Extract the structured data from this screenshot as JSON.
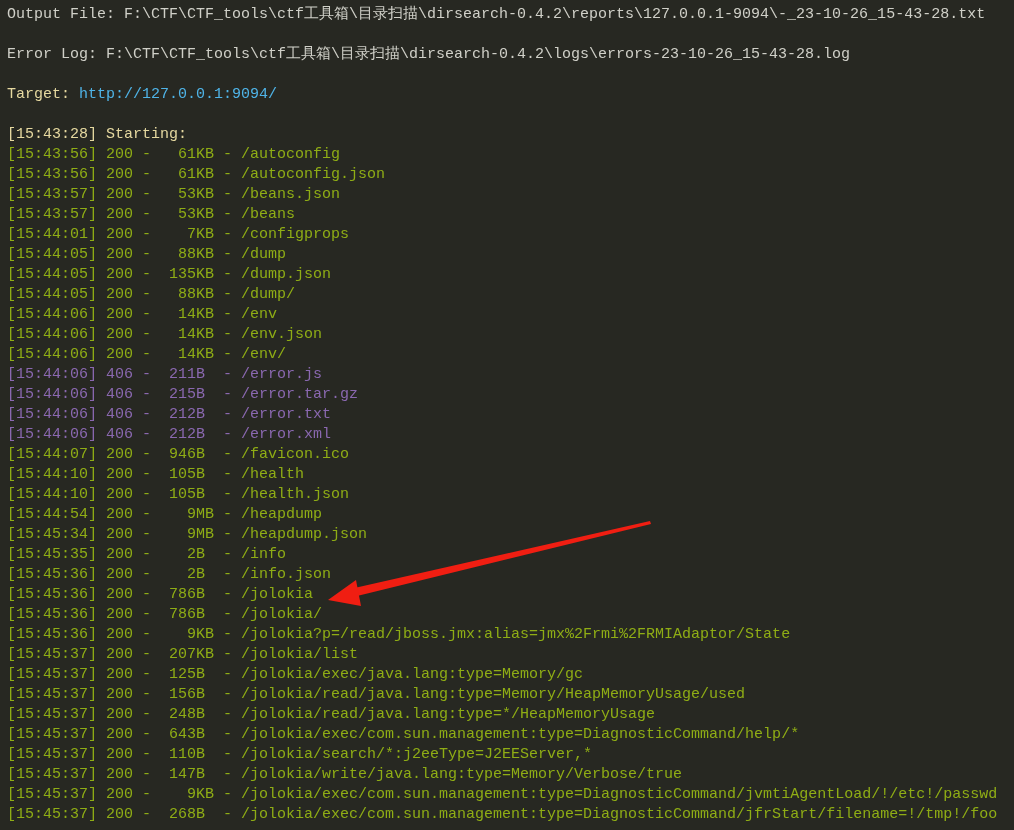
{
  "header": [
    {
      "kind": "plain",
      "text": "Output File: F:\\CTF\\CTF_tools\\ctf工具箱\\目录扫描\\dirsearch-0.4.2\\reports\\127.0.0.1-9094\\-_23-10-26_15-43-28.txt"
    },
    {
      "kind": "plain",
      "text": "Error Log: F:\\CTF\\CTF_tools\\ctf工具箱\\目录扫描\\dirsearch-0.4.2\\logs\\errors-23-10-26_15-43-28.log"
    },
    {
      "kind": "target",
      "label": "Target:",
      "url": "http://127.0.0.1:9094/"
    }
  ],
  "start_line": "[15:43:28] Starting:",
  "rows": [
    {
      "text": "[15:43:56] 200 -   61KB - /autoconfig",
      "color": "#8fad15"
    },
    {
      "text": "[15:43:56] 200 -   61KB - /autoconfig.json",
      "color": "#8fad15"
    },
    {
      "text": "[15:43:57] 200 -   53KB - /beans.json",
      "color": "#8fad15"
    },
    {
      "text": "[15:43:57] 200 -   53KB - /beans",
      "color": "#8fad15"
    },
    {
      "text": "[15:44:01] 200 -    7KB - /configprops",
      "color": "#8fad15"
    },
    {
      "text": "[15:44:05] 200 -   88KB - /dump",
      "color": "#8fad15"
    },
    {
      "text": "[15:44:05] 200 -  135KB - /dump.json",
      "color": "#8fad15"
    },
    {
      "text": "[15:44:05] 200 -   88KB - /dump/",
      "color": "#8fad15"
    },
    {
      "text": "[15:44:06] 200 -   14KB - /env",
      "color": "#8fad15"
    },
    {
      "text": "[15:44:06] 200 -   14KB - /env.json",
      "color": "#8fad15"
    },
    {
      "text": "[15:44:06] 200 -   14KB - /env/",
      "color": "#8fad15"
    },
    {
      "text": "[15:44:06] 406 -  211B  - /error.js",
      "color": "#8a68b0"
    },
    {
      "text": "[15:44:06] 406 -  215B  - /error.tar.gz",
      "color": "#8a68b0"
    },
    {
      "text": "[15:44:06] 406 -  212B  - /error.txt",
      "color": "#8a68b0"
    },
    {
      "text": "[15:44:06] 406 -  212B  - /error.xml",
      "color": "#8a68b0"
    },
    {
      "text": "[15:44:07] 200 -  946B  - /favicon.ico",
      "color": "#8fad15"
    },
    {
      "text": "[15:44:10] 200 -  105B  - /health",
      "color": "#8fad15"
    },
    {
      "text": "[15:44:10] 200 -  105B  - /health.json",
      "color": "#8fad15"
    },
    {
      "text": "[15:44:54] 200 -    9MB - /heapdump",
      "color": "#8fad15"
    },
    {
      "text": "[15:45:34] 200 -    9MB - /heapdump.json",
      "color": "#8fad15"
    },
    {
      "text": "[15:45:35] 200 -    2B  - /info",
      "color": "#8fad15"
    },
    {
      "text": "[15:45:36] 200 -    2B  - /info.json",
      "color": "#8fad15"
    },
    {
      "text": "[15:45:36] 200 -  786B  - /jolokia",
      "color": "#8fad15"
    },
    {
      "text": "[15:45:36] 200 -  786B  - /jolokia/",
      "color": "#8fad15"
    },
    {
      "text": "[15:45:36] 200 -    9KB - /jolokia?p=/read/jboss.jmx:alias=jmx%2Frmi%2FRMIAdaptor/State",
      "color": "#8fad15"
    },
    {
      "text": "[15:45:37] 200 -  207KB - /jolokia/list",
      "color": "#8fad15"
    },
    {
      "text": "[15:45:37] 200 -  125B  - /jolokia/exec/java.lang:type=Memory/gc",
      "color": "#8fad15"
    },
    {
      "text": "[15:45:37] 200 -  156B  - /jolokia/read/java.lang:type=Memory/HeapMemoryUsage/used",
      "color": "#8fad15"
    },
    {
      "text": "[15:45:37] 200 -  248B  - /jolokia/read/java.lang:type=*/HeapMemoryUsage",
      "color": "#8fad15"
    },
    {
      "text": "[15:45:37] 200 -  643B  - /jolokia/exec/com.sun.management:type=DiagnosticCommand/help/*",
      "color": "#8fad15"
    },
    {
      "text": "[15:45:37] 200 -  110B  - /jolokia/search/*:j2eeType=J2EEServer,*",
      "color": "#8fad15"
    },
    {
      "text": "[15:45:37] 200 -  147B  - /jolokia/write/java.lang:type=Memory/Verbose/true",
      "color": "#8fad15"
    },
    {
      "text": "[15:45:37] 200 -    9KB - /jolokia/exec/com.sun.management:type=DiagnosticCommand/jvmtiAgentLoad/!/etc!/passwd",
      "color": "#8fad15"
    },
    {
      "text": "[15:45:37] 200 -  268B  - /jolokia/exec/com.sun.management:type=DiagnosticCommand/jfrStart/filename=!/tmp!/foo",
      "color": "#8fad15"
    }
  ]
}
